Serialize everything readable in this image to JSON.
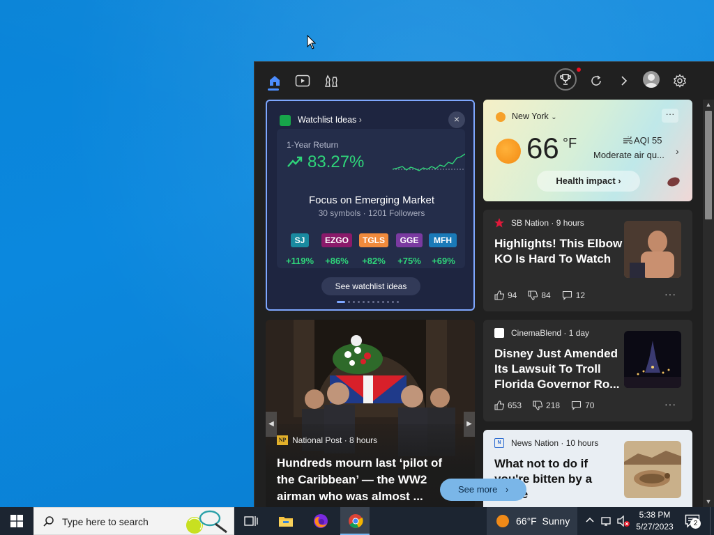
{
  "panel": {
    "topbar": {
      "tabs": [
        "home-icon",
        "video-icon",
        "games-icon"
      ],
      "actions": [
        "rewards-icon",
        "refresh-icon",
        "next-icon",
        "account-icon",
        "settings-icon"
      ]
    },
    "watchlist": {
      "title": "Watchlist Ideas",
      "chevron": "›",
      "close": "×",
      "return_label": "1-Year Return",
      "return_value": "83.27%",
      "focus_title": "Focus on Emerging Market",
      "focus_sub": "30 symbols · 1201 Followers",
      "tickers": [
        {
          "symbol": "SJ",
          "change": "+119%",
          "color": "#1a8aa0"
        },
        {
          "symbol": "EZGO",
          "change": "+86%",
          "color": "#8a1a6a"
        },
        {
          "symbol": "TGLS",
          "change": "+82%",
          "color": "#f08a3c"
        },
        {
          "symbol": "GGE",
          "change": "+75%",
          "color": "#7a3aa0"
        },
        {
          "symbol": "MFH",
          "change": "+69%",
          "color": "#1a7ab8"
        }
      ],
      "button": "See watchlist ideas"
    },
    "weather": {
      "city": "New York",
      "more": "···",
      "temp": "66",
      "unit": "°F",
      "aqi": "AQI 55",
      "aqi_desc": "Moderate air qu...",
      "health": "Health impact ›"
    },
    "news": [
      {
        "source": "SB Nation · 9 hours",
        "headline": "Highlights! This Elbow KO Is Hard To Watch",
        "likes": "94",
        "dislikes": "84",
        "comments": "12"
      },
      {
        "source": "CinemaBlend · 1 day",
        "headline": "Disney Just Amended Its Lawsuit To Troll Florida Governor Ro...",
        "likes": "653",
        "dislikes": "218",
        "comments": "70"
      },
      {
        "source": "News Nation · 10 hours",
        "headline": "What not to do if you're bitten by a snake"
      }
    ],
    "hero": {
      "source": "National Post · 8 hours",
      "source_badge": "NP",
      "headline": "Hundreds mourn last ‘pilot of the Caribbean’ — the WW2 airman who was almost ..."
    },
    "see_more": "See more"
  },
  "taskbar": {
    "search_placeholder": "Type here to search",
    "weather": "66°F  Sunny",
    "time": "5:38 PM",
    "date": "5/27/2023",
    "notifications": "2"
  }
}
